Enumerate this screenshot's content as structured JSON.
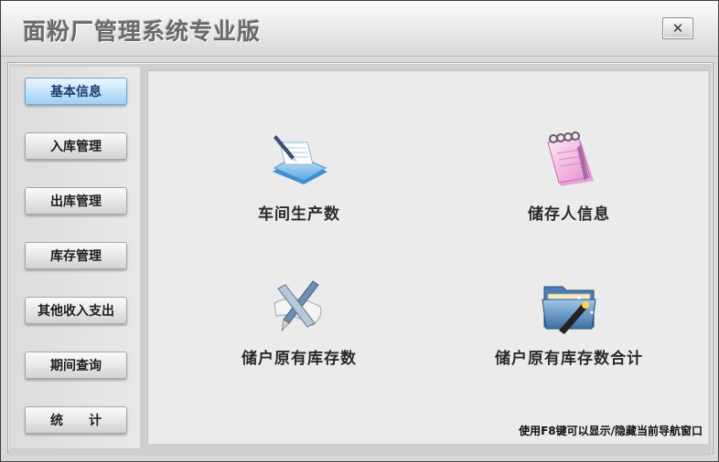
{
  "window": {
    "title": "面粉厂管理系统专业版",
    "close_label": "✕"
  },
  "sidebar": {
    "items": [
      {
        "label": "基本信息",
        "active": true
      },
      {
        "label": "入库管理"
      },
      {
        "label": "出库管理"
      },
      {
        "label": "库存管理"
      },
      {
        "label": "其他收入支出"
      },
      {
        "label": "期间查询"
      },
      {
        "label": "统　　计"
      }
    ]
  },
  "main": {
    "items": [
      {
        "label": "车间生产数",
        "icon": "notepad-pen-icon"
      },
      {
        "label": "储存人信息",
        "icon": "spiral-notebook-icon"
      },
      {
        "label": "储户原有库存数",
        "icon": "pen-scroll-icon"
      },
      {
        "label": "储户原有库存数合计",
        "icon": "folder-wand-icon"
      }
    ],
    "hint": "使用F8键可以显示/隐藏当前导航窗口"
  },
  "colors": {
    "accent": "#9fd0f4",
    "background": "#ebebeb"
  }
}
